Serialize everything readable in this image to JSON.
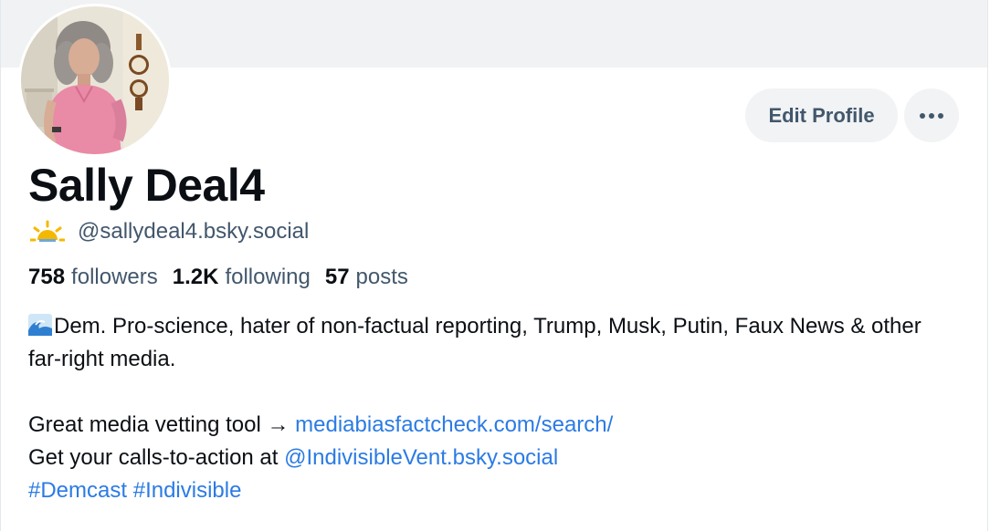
{
  "profile": {
    "display_name": "Sally Deal4",
    "handle": "@sallydeal4.bsky.social",
    "handle_emoji": "sun-behind-cloud",
    "avatar_icon": "profile-photo",
    "buttons": {
      "edit_profile": "Edit Profile",
      "more_icon": "ellipsis-icon"
    },
    "stats": {
      "followers_count": "758",
      "followers_label": "followers",
      "following_count": "1.2K",
      "following_label": "following",
      "posts_count": "57",
      "posts_label": "posts"
    },
    "bio": {
      "line1_emoji": "water-wave",
      "line1": "Dem. Pro-science, hater of non-factual reporting, Trump, Musk, Putin, Faux News & other far-right media.",
      "tool_prefix": "Great media vetting tool → ",
      "tool_link": "mediabiasfactcheck.com/search/",
      "cta_prefix": "Get your calls-to-action at ",
      "cta_link": "@IndivisibleVent.bsky.social",
      "hashtag1": "#Demcast",
      "hashtag2": "#Indivisible"
    }
  },
  "colors": {
    "banner": "#f1f2f3",
    "button_bg": "#f1f3f5",
    "muted_text": "#42576c",
    "link": "#2b7be4",
    "text": "#0b0f14"
  }
}
